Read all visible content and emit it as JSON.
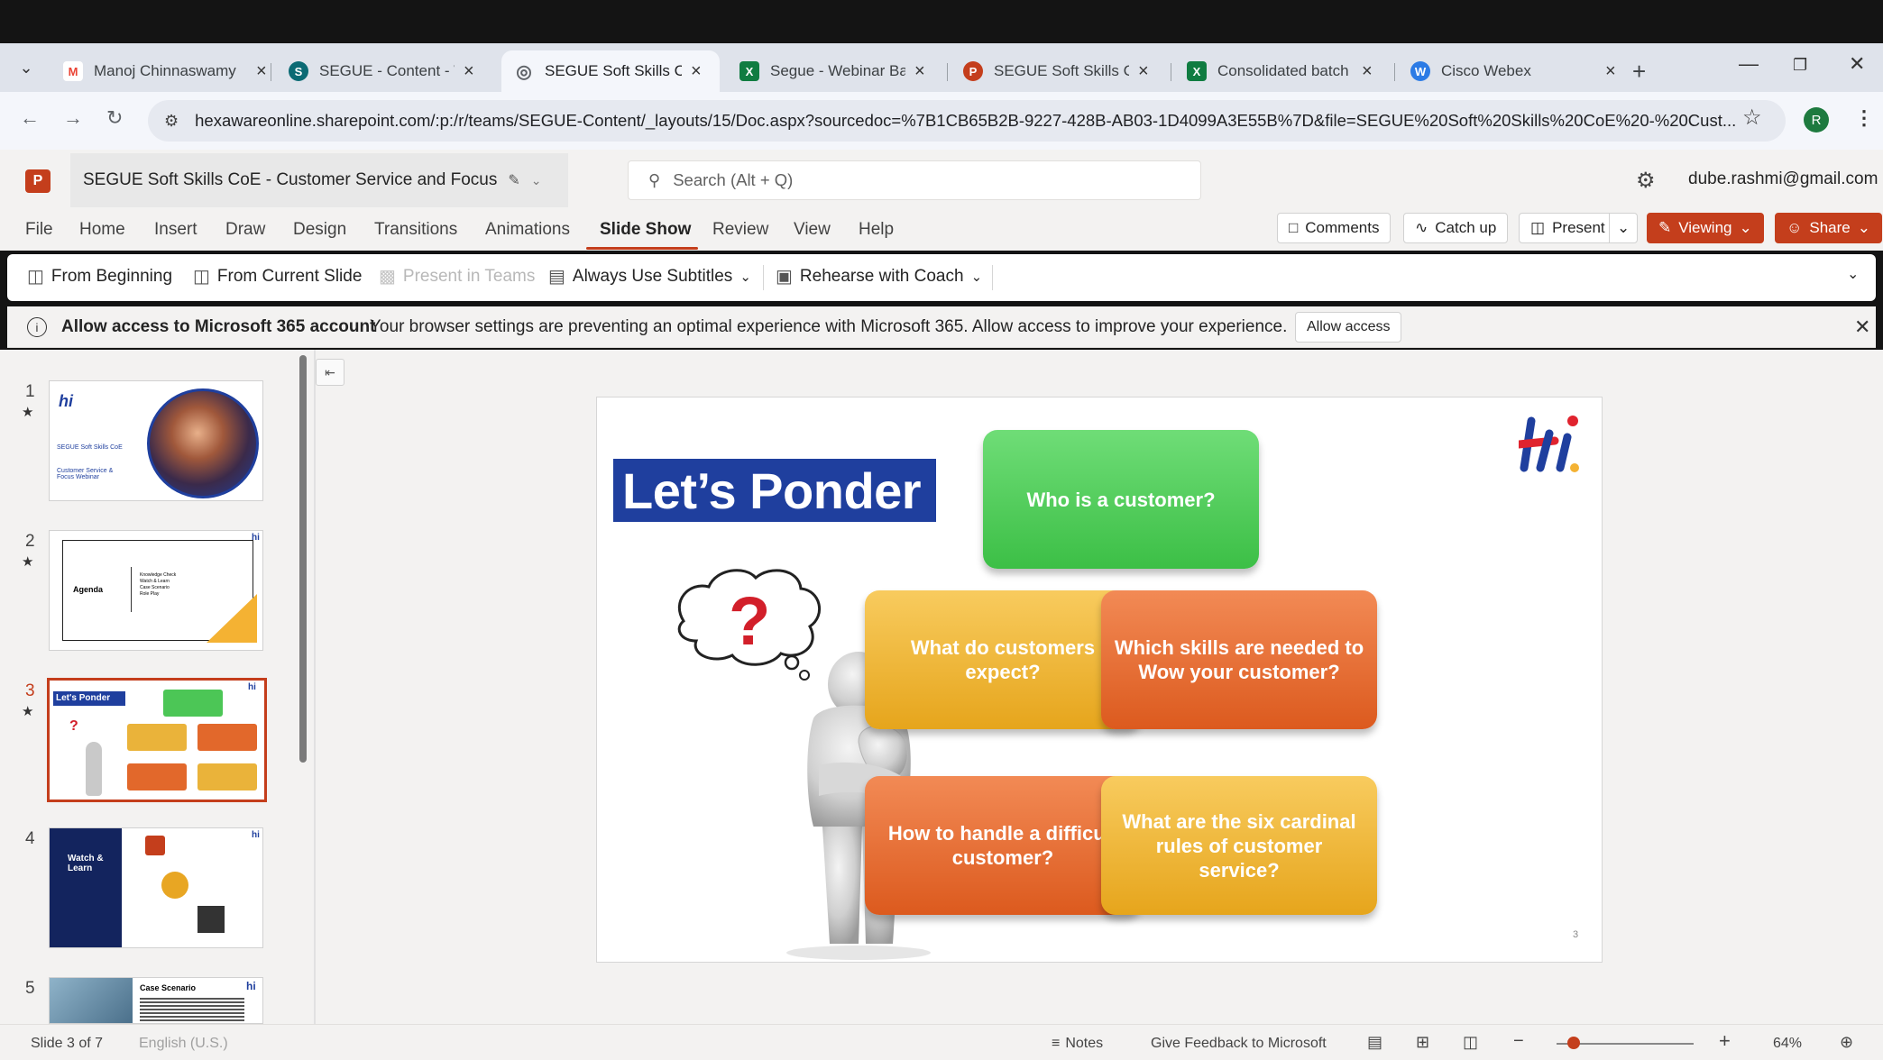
{
  "browser": {
    "tabs": [
      {
        "label": "Manoj Chinnaswamy",
        "icon": "gmail-icon",
        "color": "#ea4335"
      },
      {
        "label": "SEGUE - Content - W",
        "icon": "sharepoint-icon",
        "color": "#0b6a74"
      },
      {
        "label": "SEGUE Soft Skills CoE",
        "icon": "globe-icon",
        "color": "#5f6368"
      },
      {
        "label": "Segue - Webinar Bat",
        "icon": "excel-icon",
        "color": "#107c41"
      },
      {
        "label": "SEGUE Soft Skills Co",
        "icon": "powerpoint-icon",
        "color": "#c43e1c"
      },
      {
        "label": "Consolidated batch s",
        "icon": "excel-icon",
        "color": "#107c41"
      },
      {
        "label": "Cisco Webex",
        "icon": "webex-icon",
        "color": "#2c7be5"
      }
    ],
    "url": "hexawareonline.sharepoint.com/:p:/r/teams/SEGUE-Content/_layouts/15/Doc.aspx?sourcedoc=%7B1CB65B2B-9227-428B-AB03-1D4099A3E55B%7D&file=SEGUE%20Soft%20Skills%20CoE%20-%20Cust...",
    "profile_initial": "R"
  },
  "app": {
    "doc_title": "SEGUE Soft Skills CoE - Customer Service and Focus",
    "search_placeholder": "Search (Alt + Q)",
    "user": "dube.rashmi@gmail.com",
    "accent": "#c43e1c"
  },
  "ribbon": {
    "tabs": [
      "File",
      "Home",
      "Insert",
      "Draw",
      "Design",
      "Transitions",
      "Animations",
      "Slide Show",
      "Review",
      "View",
      "Help"
    ],
    "active_tab": "Slide Show",
    "comments": "Comments",
    "catchup": "Catch up",
    "present": "Present",
    "viewing": "Viewing",
    "share": "Share"
  },
  "commands": {
    "from_beginning": "From Beginning",
    "from_current": "From Current Slide",
    "present_teams": "Present in Teams",
    "subtitles": "Always Use Subtitles",
    "rehearse": "Rehearse with Coach"
  },
  "infobar": {
    "title": "Allow access to Microsoft 365 account",
    "message": "Your browser settings are preventing an optimal experience with Microsoft 365. Allow access to improve your experience.",
    "button": "Allow access"
  },
  "thumbnails": [
    {
      "num": "1"
    },
    {
      "num": "2"
    },
    {
      "num": "3"
    },
    {
      "num": "4"
    },
    {
      "num": "5"
    }
  ],
  "thumb_text": {
    "t1_title": "SEGUE Soft Skills CoE",
    "t1_sub": "Customer Service & Focus Webinar",
    "t2_agenda": "Agenda",
    "t2_items": "Knowledge Check\nWatch & Learn\nCase Scenario\nRole Play",
    "t3_title": "Let's Ponder",
    "t4_title": "Watch & Learn",
    "t5_title": "Case Scenario"
  },
  "slide": {
    "title": "Let’s Ponder",
    "questions": {
      "q1": "Who is a customer?",
      "q2": "What do customers expect?",
      "q3": "Which skills are needed to Wow your customer?",
      "q4": "How to handle a difficult customer?",
      "q5": "What are the six cardinal rules of customer service?"
    },
    "page_number": "3"
  },
  "status": {
    "slide_of": "Slide 3 of 7",
    "language": "English (U.S.)",
    "notes": "Notes",
    "feedback": "Give Feedback to Microsoft",
    "zoom": "64%"
  }
}
